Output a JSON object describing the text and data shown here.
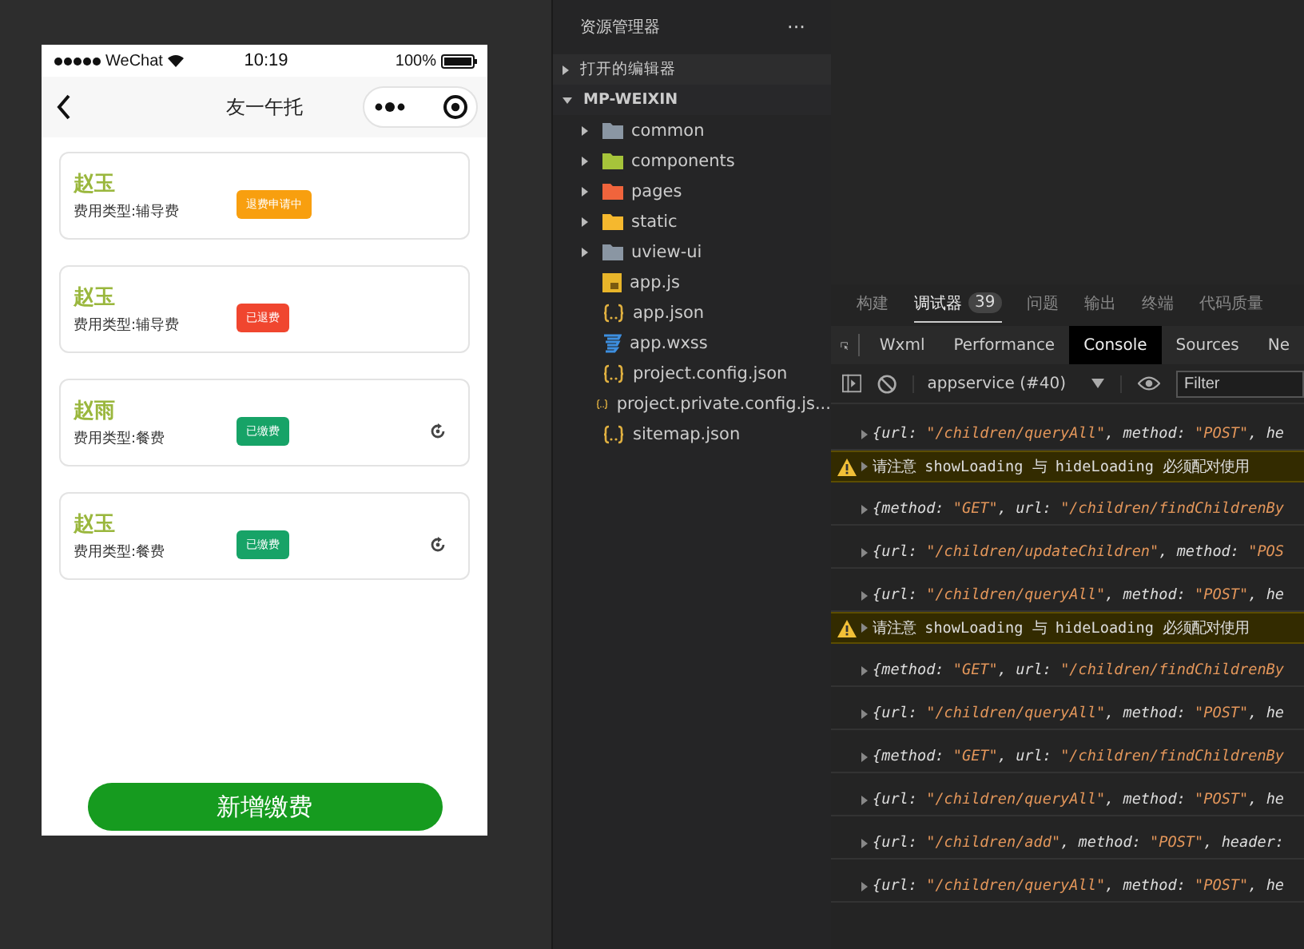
{
  "phone": {
    "status_bar": {
      "carrier": "WeChat",
      "time": "10:19",
      "battery": "100%"
    },
    "nav": {
      "title": "友一午托"
    },
    "records": [
      {
        "name": "赵玉",
        "fee_type": "费用类型:辅导费",
        "status": "退费申请中",
        "color": "#f89f0f",
        "has_icon": false
      },
      {
        "name": "赵玉",
        "fee_type": "费用类型:辅导费",
        "status": "已退费",
        "color": "#f0462f",
        "has_icon": false
      },
      {
        "name": "赵雨",
        "fee_type": "费用类型:餐费",
        "status": "已缴费",
        "color": "#17a367",
        "has_icon": true
      },
      {
        "name": "赵玉",
        "fee_type": "费用类型:餐费",
        "status": "已缴费",
        "color": "#17a367",
        "has_icon": true
      }
    ],
    "add_button": "新增缴费"
  },
  "explorer": {
    "title": "资源管理器",
    "more": "···",
    "sections": [
      {
        "label": "打开的编辑器",
        "expanded": false
      },
      {
        "label": "MP-WEIXIN",
        "expanded": true
      }
    ],
    "items": [
      {
        "kind": "folder",
        "label": "common",
        "color": "#8a96a3"
      },
      {
        "kind": "folder",
        "label": "components",
        "color": "#a6c43a"
      },
      {
        "kind": "folder",
        "label": "pages",
        "color": "#f0643c"
      },
      {
        "kind": "folder",
        "label": "static",
        "color": "#f5b82e"
      },
      {
        "kind": "folder",
        "label": "uview-ui",
        "color": "#8a96a3"
      },
      {
        "kind": "js",
        "label": "app.js"
      },
      {
        "kind": "json",
        "label": "app.json"
      },
      {
        "kind": "css",
        "label": "app.wxss"
      },
      {
        "kind": "json",
        "label": "project.config.json"
      },
      {
        "kind": "json",
        "label": "project.private.config.js..."
      },
      {
        "kind": "json",
        "label": "sitemap.json"
      }
    ]
  },
  "devtools": {
    "tabs": [
      {
        "label": "构建",
        "selected": false
      },
      {
        "label": "调试器",
        "selected": true,
        "badge": "39"
      },
      {
        "label": "问题",
        "selected": false
      },
      {
        "label": "输出",
        "selected": false
      },
      {
        "label": "终端",
        "selected": false
      },
      {
        "label": "代码质量",
        "selected": false
      }
    ],
    "panels": [
      {
        "label": "Wxml",
        "selected": false
      },
      {
        "label": "Performance",
        "selected": false
      },
      {
        "label": "Console",
        "selected": true
      },
      {
        "label": "Sources",
        "selected": false
      },
      {
        "label": "Ne",
        "selected": false
      }
    ],
    "context": "appservice (#40)",
    "filter": {
      "placeholder": "Filter"
    },
    "console": [
      {
        "kind": "log",
        "text": "{url: \"/children/queryAll\", method: \"POST\", he"
      },
      {
        "kind": "warning",
        "text": "请注意 showLoading 与 hideLoading 必须配对使用"
      },
      {
        "kind": "log",
        "text": "{method: \"GET\", url: \"/children/findChildrenBy"
      },
      {
        "kind": "log",
        "text": "{url: \"/children/updateChildren\", method: \"POS"
      },
      {
        "kind": "log",
        "text": "{url: \"/children/queryAll\", method: \"POST\", he"
      },
      {
        "kind": "warning",
        "text": "请注意 showLoading 与 hideLoading 必须配对使用"
      },
      {
        "kind": "log",
        "text": "{method: \"GET\", url: \"/children/findChildrenBy"
      },
      {
        "kind": "log",
        "text": "{url: \"/children/queryAll\", method: \"POST\", he"
      },
      {
        "kind": "log",
        "text": "{method: \"GET\", url: \"/children/findChildrenBy"
      },
      {
        "kind": "log",
        "text": "{url: \"/children/queryAll\", method: \"POST\", he"
      },
      {
        "kind": "log",
        "text": "{url: \"/children/add\", method: \"POST\", header:"
      },
      {
        "kind": "log",
        "text": "{url: \"/children/queryAll\", method: \"POST\", he"
      }
    ]
  }
}
